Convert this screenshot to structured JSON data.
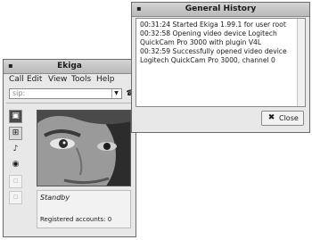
{
  "ekiga": {
    "title": "Ekiga",
    "menus": [
      "Call",
      "Edit",
      "View",
      "Tools",
      "Help"
    ],
    "url_value": "sip:",
    "status": "Standby",
    "accounts": "Registered accounts: 0"
  },
  "history": {
    "title": "General History",
    "lines": [
      "00:31:24 Started Ekiga 1.99.1 for user root",
      "00:32:58 Opening video device Logitech",
      "QuickCam Pro 3000 with plugin V4L",
      "00:32:59 Successfully opened video device",
      "Logitech QuickCam Pro 3000, channel 0"
    ],
    "close_label": "Close"
  }
}
